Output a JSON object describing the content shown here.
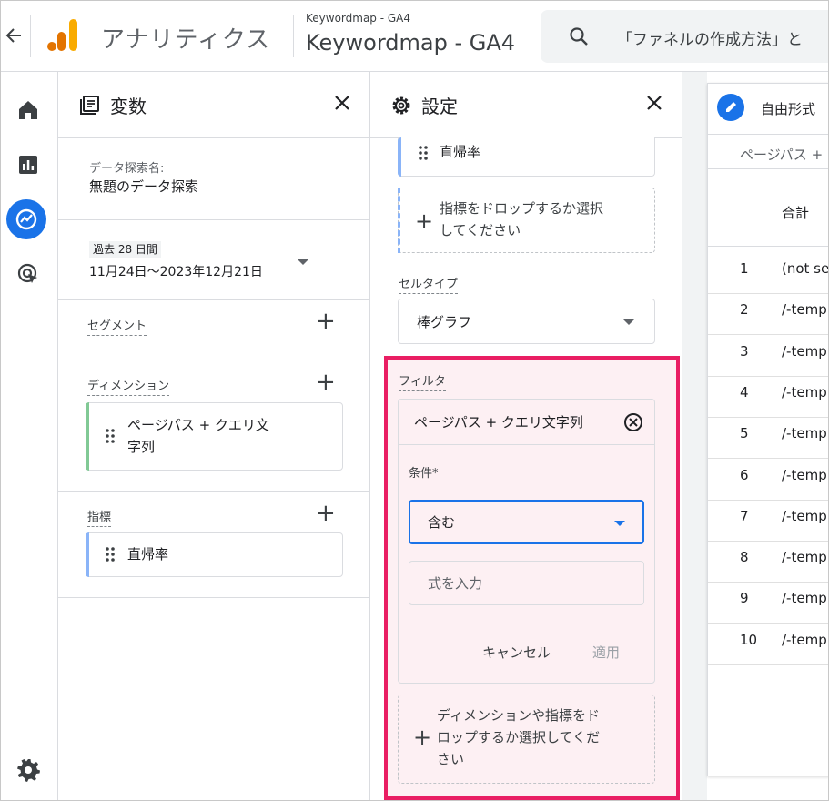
{
  "header": {
    "back_icon": "arrow-left-icon",
    "app_name": "アナリティクス",
    "account_small": "Keywordmap - GA4",
    "account_big": "Keywordmap - GA4",
    "search_text": "「ファネルの作成方法」と"
  },
  "rail": {
    "icons": [
      "home-icon",
      "reports-icon",
      "explore-icon",
      "advertising-icon",
      "settings-icon"
    ]
  },
  "variables": {
    "title": "変数",
    "exploration_label": "データ探索名:",
    "exploration_name": "無題のデータ探索",
    "date_badge": "過去 28 日間",
    "date_range": "11月24日〜2023年12月21日",
    "segment_label": "セグメント",
    "dimension_label": "ディメンション",
    "dimension_item_line1": "ページパス + クエリ文",
    "dimension_item_line2": "字列",
    "metric_label": "指標",
    "metric_item": "直帰率"
  },
  "settings": {
    "title": "設定",
    "metric_chip": "直帰率",
    "metric_drop_line1": "指標をドロップするか選択",
    "metric_drop_line2": "してください",
    "cell_type_label": "セルタイプ",
    "cell_type_value": "棒グラフ",
    "filter_label": "フィルタ",
    "filter_dimension": "ページパス + クエリ文字列",
    "condition_label": "条件*",
    "condition_value": "含む",
    "expression_placeholder": "式を入力",
    "cancel_label": "キャンセル",
    "apply_label": "適用",
    "filter_drop_line1": "ディメンションや指標をド",
    "filter_drop_line2": "ロップするか選択してくだ",
    "filter_drop_line3": "さい"
  },
  "table": {
    "tab_title": "自由形式",
    "column_header": "ページパス +",
    "total_label": "合計",
    "rows": [
      {
        "num": "1",
        "text": "(not set)"
      },
      {
        "num": "2",
        "text": "/-templ"
      },
      {
        "num": "3",
        "text": "/-templ"
      },
      {
        "num": "4",
        "text": "/-templ"
      },
      {
        "num": "5",
        "text": "/-templ"
      },
      {
        "num": "6",
        "text": "/-templ"
      },
      {
        "num": "7",
        "text": "/-templ"
      },
      {
        "num": "8",
        "text": "/-templ"
      },
      {
        "num": "9",
        "text": "/-templ"
      },
      {
        "num": "10",
        "text": "/-templ"
      }
    ]
  },
  "colors": {
    "accent": "#1a73e8",
    "highlight_border": "#e91e63",
    "highlight_fill": "#fdf0f3",
    "dimension_bar": "#81c995",
    "metric_bar": "#8ab4f8"
  }
}
